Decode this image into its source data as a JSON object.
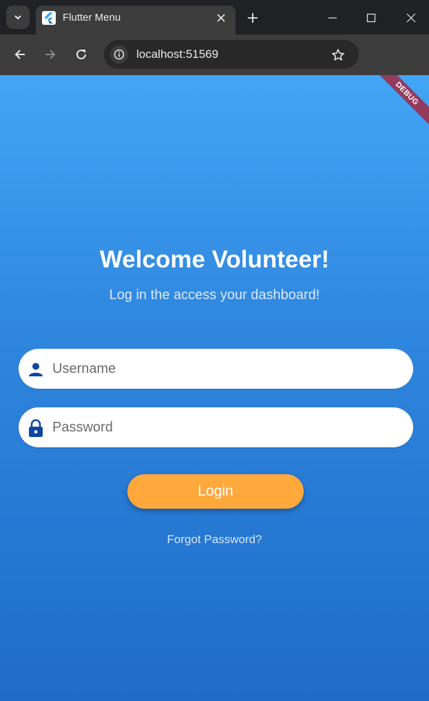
{
  "browser": {
    "tab_title": "Flutter Menu",
    "url": "localhost:51569"
  },
  "app": {
    "debug_banner": "DEBUG",
    "welcome_title": "Welcome Volunteer!",
    "subtitle": "Log in the access your dashboard!",
    "username_placeholder": "Username",
    "password_placeholder": "Password",
    "login_label": "Login",
    "forgot_password": "Forgot Password?"
  },
  "colors": {
    "gradient_top": "#42a5f5",
    "gradient_bottom": "#1e6cc8",
    "login_button": "#ffa83b",
    "field_icon": "#0d47a1"
  },
  "icons": [
    "tab-search-icon",
    "flutter-logo-icon",
    "close-icon",
    "plus-icon",
    "minimize-icon",
    "maximize-icon",
    "back-icon",
    "forward-icon",
    "reload-icon",
    "site-info-icon",
    "star-icon",
    "profile-icon",
    "menu-icon",
    "person-icon",
    "lock-icon"
  ]
}
